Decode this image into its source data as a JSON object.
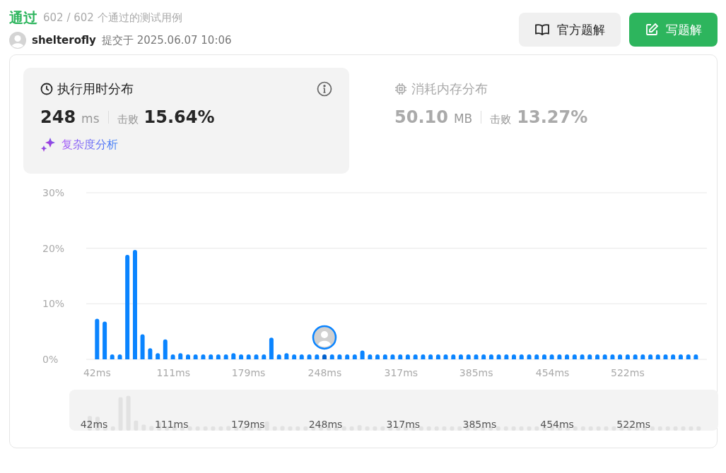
{
  "header": {
    "status": "通过",
    "passed_summary": "602 / 602 个通过的测试用例",
    "user": "shelterofly",
    "submitted": "提交于 2025.06.07 10:06"
  },
  "buttons": [
    {
      "label": "官方题解",
      "kind": "secondary"
    },
    {
      "label": "写题解",
      "kind": "primary"
    }
  ],
  "stats": [
    {
      "kind": "runtime",
      "title": "执行用时分布",
      "selected": true,
      "value": "248",
      "unit": "ms",
      "beats_label": "击败",
      "beats": "15.64%",
      "link": "复杂度分析"
    },
    {
      "kind": "memory",
      "title": "消耗内存分布",
      "selected": false,
      "value": "50.10",
      "unit": "MB",
      "beats_label": "击败",
      "beats": "13.27%"
    }
  ],
  "chart_data": {
    "type": "bar",
    "ylim": [
      0,
      30
    ],
    "xlim": [
      32.2,
      593.7
    ],
    "yticks": [
      {
        "value": 0,
        "label": "0%"
      },
      {
        "value": 10,
        "label": "10%"
      },
      {
        "value": 20,
        "label": "20%"
      },
      {
        "value": 30,
        "label": "30%"
      }
    ],
    "xticks": [
      {
        "value": 42,
        "label": "42ms"
      },
      {
        "value": 111,
        "label": "111ms"
      },
      {
        "value": 179,
        "label": "179ms"
      },
      {
        "value": 248,
        "label": "248ms"
      },
      {
        "value": 317,
        "label": "317ms"
      },
      {
        "value": 385,
        "label": "385ms"
      },
      {
        "value": 454,
        "label": "454ms"
      },
      {
        "value": 522,
        "label": "522ms"
      }
    ],
    "x": [
      42.0,
      48.9,
      55.7,
      62.6,
      69.4,
      76.3,
      83.1,
      90.0,
      96.9,
      103.7,
      110.6,
      117.4,
      124.3,
      131.1,
      138.0,
      144.9,
      151.7,
      158.6,
      165.4,
      172.3,
      179.1,
      186.0,
      192.9,
      199.7,
      206.6,
      213.4,
      220.3,
      227.1,
      234.0,
      240.9,
      247.7,
      254.6,
      261.4,
      268.3,
      275.1,
      282.0,
      288.9,
      295.7,
      302.6,
      309.4,
      316.3,
      323.1,
      330.0,
      336.9,
      343.7,
      350.6,
      357.4,
      364.3,
      371.1,
      378.0,
      384.9,
      391.7,
      398.6,
      405.4,
      412.3,
      419.1,
      426.0,
      432.9,
      439.7,
      446.6,
      453.4,
      460.3,
      467.1,
      474.0,
      480.9,
      487.7,
      494.6,
      501.4,
      508.3,
      515.1,
      522.0,
      528.9,
      535.7,
      542.6,
      549.4,
      556.3,
      563.1,
      570.0,
      576.9,
      583.7
    ],
    "values": [
      7.3,
      6.8,
      0.9,
      0.9,
      18.8,
      19.7,
      4.5,
      2.0,
      1.1,
      3.6,
      0.9,
      1.1,
      0.9,
      0.9,
      0.9,
      0.9,
      0.9,
      0.9,
      1.1,
      0.9,
      0.9,
      0.9,
      0.9,
      3.9,
      0.9,
      1.1,
      0.9,
      0.9,
      0.9,
      0.9,
      0.9,
      0.9,
      0.9,
      0.9,
      0.9,
      1.6,
      0.9,
      0.9,
      0.9,
      0.9,
      0.9,
      0.9,
      0.9,
      0.9,
      0.9,
      0.9,
      0.9,
      0.9,
      0.9,
      0.9,
      0.9,
      0.9,
      0.9,
      0.9,
      0.9,
      0.9,
      0.9,
      0.9,
      0.9,
      0.9,
      0.9,
      0.9,
      0.9,
      0.9,
      0.9,
      0.9,
      0.9,
      0.9,
      0.9,
      0.9,
      0.9,
      0.9,
      0.9,
      0.9,
      0.9,
      0.9,
      0.9,
      0.9,
      0.9,
      0.9
    ]
  },
  "navigator": {
    "labels": [
      "42ms",
      "111ms",
      "179ms",
      "248ms",
      "317ms",
      "385ms",
      "454ms",
      "522ms"
    ]
  }
}
